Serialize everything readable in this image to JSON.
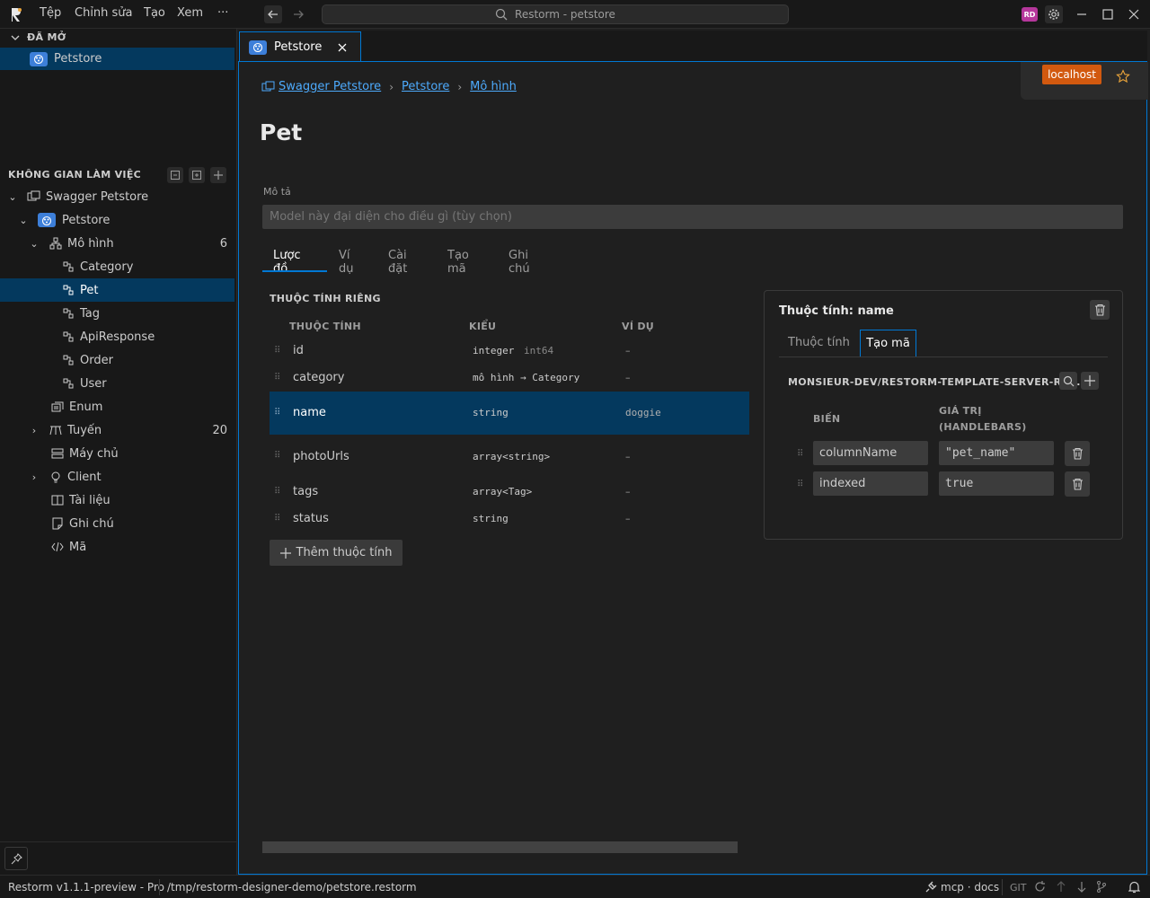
{
  "menu": {
    "items": [
      "Tệp",
      "Chỉnh sửa",
      "Tạo",
      "Xem",
      "···"
    ]
  },
  "search": {
    "text": "Restorm - petstore"
  },
  "user": {
    "initials": "RD",
    "color": "#b5379b"
  },
  "sidebar": {
    "open_title": "ĐÃ MỞ",
    "open_items": [
      {
        "label": "Petstore"
      }
    ],
    "workspace_title": "KHÔNG GIAN LÀM VIỆC",
    "tree": {
      "root": "Swagger Petstore",
      "api": "Petstore",
      "models": {
        "label": "Mô hình",
        "count": "6",
        "items": [
          "Category",
          "Pet",
          "Tag",
          "ApiResponse",
          "Order",
          "User"
        ]
      },
      "enum": "Enum",
      "routes": {
        "label": "Tuyến",
        "count": "20"
      },
      "servers": "Máy chủ",
      "client": "Client",
      "docs": "Tài liệu",
      "notes": "Ghi chú",
      "code": "Mã"
    }
  },
  "editor": {
    "tab": {
      "label": "Petstore"
    },
    "env_badge": "localhost",
    "breadcrumb": [
      "Swagger Petstore",
      "Petstore",
      "Mô hình"
    ],
    "title": "Pet",
    "description": {
      "label": "Mô tả",
      "placeholder": "Model này đại diện cho điều gì (tùy chọn)"
    },
    "tabs": [
      "Lược đồ",
      "Ví dụ",
      "Cài đặt",
      "Tạo mã",
      "Ghi chú"
    ],
    "props_section": "THUỘC TÍNH RIÊNG",
    "columns": {
      "prop": "THUỘC TÍNH",
      "type": "KIỂU",
      "example": "VÍ DỤ"
    },
    "rows": [
      {
        "name": "id",
        "type": "integer",
        "format": "int64",
        "example": "–"
      },
      {
        "name": "category",
        "type": "mô hình → Category",
        "format": "",
        "example": "–"
      },
      {
        "name": "name",
        "type": "string",
        "format": "",
        "example": "doggie"
      },
      {
        "name": "photoUrls",
        "type": "array<string>",
        "format": "",
        "example": "–"
      },
      {
        "name": "tags",
        "type": "array<Tag>",
        "format": "",
        "example": "–"
      },
      {
        "name": "status",
        "type": "string",
        "format": "",
        "example": "–"
      }
    ],
    "add_property": "Thêm thuộc tính"
  },
  "panel": {
    "title": "Thuộc tính: name",
    "tabs": [
      "Thuộc tính",
      "Tạo mã"
    ],
    "template": "MONSIEUR-DEV/RESTORM-TEMPLATE-SERVER-RE...",
    "col_var": "BIẾN",
    "col_value_line1": "GIÁ TRỊ",
    "col_value_line2": "(HANDLEBARS)",
    "vars": [
      {
        "name": "columnName",
        "value": "\"pet_name\""
      },
      {
        "name": "indexed",
        "value": "true"
      }
    ]
  },
  "status": {
    "version": "Restorm v1.1.1-preview - Pro",
    "path": "/tmp/restorm-designer-demo/petstore.restorm",
    "mcp": "mcp · docs",
    "git": "GIT"
  },
  "colors": {
    "accent": "#0078d4",
    "selection": "#04395e",
    "link": "#4daafc",
    "env": "#d2590f"
  }
}
